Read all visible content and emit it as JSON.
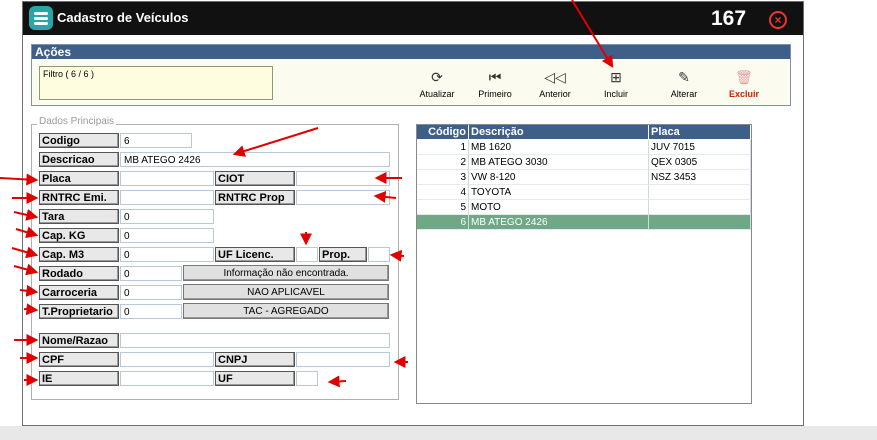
{
  "window": {
    "title": "Cadastro de Veículos",
    "record_count": "167",
    "close_icon": "close-circle-icon"
  },
  "acoes": {
    "header": "Ações",
    "filter_text": "Filtro ( 6 / 6 )",
    "tools": [
      {
        "label": "Atualizar",
        "icon": "refresh-icon"
      },
      {
        "label": "Primeiro",
        "icon": "first-record-icon"
      },
      {
        "label": "Anterior",
        "icon": "previous-record-icon"
      },
      {
        "label": "Incluir",
        "icon": "add-document-icon"
      },
      {
        "label": "Alterar",
        "icon": "edit-document-icon"
      },
      {
        "label": "Excluir",
        "icon": "trash-icon"
      }
    ]
  },
  "dados": {
    "legend": "Dados Principais",
    "labels": {
      "codigo": "Codigo",
      "descricao": "Descricao",
      "placa": "Placa",
      "ciot": "CIOT",
      "rntrc_emi": "RNTRC Emi.",
      "rntrc_prop": "RNTRC Prop",
      "tara": "Tara",
      "cap_kg": "Cap. KG",
      "cap_m3": "Cap. M3",
      "uf_licenc": "UF Licenc.",
      "prop": "Prop.",
      "rodado": "Rodado",
      "carroceria": "Carroceria",
      "t_proprietario": "T.Proprietario",
      "nome_razao": "Nome/Razao",
      "cpf": "CPF",
      "cnpj": "CNPJ",
      "ie": "IE",
      "uf": "UF"
    },
    "values": {
      "codigo": "6",
      "descricao": "MB ATEGO 2426",
      "tara": "0",
      "cap_kg": "0",
      "cap_m3": "0",
      "rodado": "0",
      "carroceria": "0",
      "t_proprietario": "0",
      "rodado_desc": "Informação não encontrada.",
      "carroceria_desc": "NAO APLICAVEL",
      "t_proprietario_desc": "TAC - AGREGADO"
    }
  },
  "grid": {
    "columns": [
      "Código",
      "Descrição",
      "Placa"
    ],
    "rows": [
      {
        "codigo": "1",
        "descricao": "MB 1620",
        "placa": "JUV 7015"
      },
      {
        "codigo": "2",
        "descricao": "MB ATEGO 3030",
        "placa": "QEX 0305"
      },
      {
        "codigo": "3",
        "descricao": "VW 8-120",
        "placa": "NSZ 3453"
      },
      {
        "codigo": "4",
        "descricao": "TOYOTA",
        "placa": ""
      },
      {
        "codigo": "5",
        "descricao": "MOTO",
        "placa": ""
      },
      {
        "codigo": "6",
        "descricao": "MB ATEGO 2426",
        "placa": ""
      }
    ],
    "selected_row": 6
  },
  "colors": {
    "titlebar": "#111111",
    "header": "#3d5f8a",
    "selected_row": "#6ea885",
    "annotation_arrow": "#e00000"
  }
}
